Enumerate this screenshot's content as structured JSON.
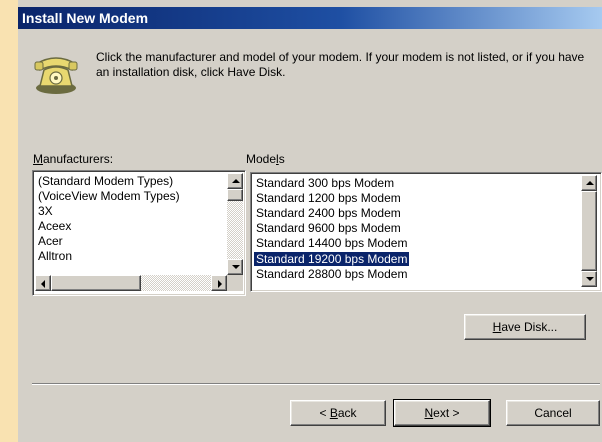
{
  "window": {
    "title": "Install New Modem"
  },
  "instructions": "Click the manufacturer and model of your modem. If your modem is not listed, or if you have an installation disk, click Have Disk.",
  "manufacturers": {
    "label_accel": "M",
    "label_rest": "anufacturers:",
    "items": [
      "(Standard Modem Types)",
      "(VoiceView Modem Types)",
      "3X",
      "Aceex",
      "Acer",
      "Alltron"
    ]
  },
  "models": {
    "label_pre": "Mode",
    "label_accel": "l",
    "label_post": "s",
    "items": [
      "Standard   300 bps Modem",
      "Standard  1200 bps Modem",
      "Standard  2400 bps Modem",
      "Standard  9600 bps Modem",
      "Standard 14400 bps Modem",
      "Standard 19200 bps Modem",
      "Standard 28800 bps Modem"
    ],
    "selected": "Standard 19200 bps Modem"
  },
  "buttons": {
    "have_disk_accel": "H",
    "have_disk_rest": "ave Disk...",
    "back_pre": "< ",
    "back_accel": "B",
    "back_rest": "ack",
    "next_accel": "N",
    "next_rest": "ext >",
    "cancel": "Cancel"
  },
  "colors": {
    "desktop": "#f9e2b1",
    "dialog": "#d4d0c8",
    "titlebar": "#0a246a",
    "selection": "#0a246a"
  }
}
